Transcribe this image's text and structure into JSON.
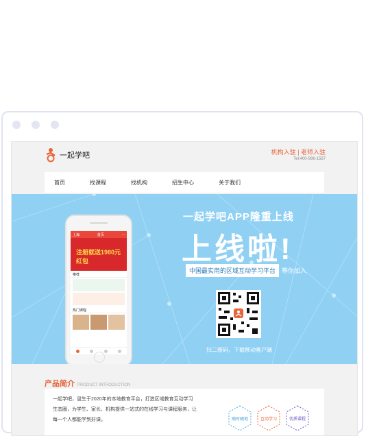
{
  "header": {
    "logo_text": "一起学吧",
    "links": "机构入驻 | 老师入驻",
    "phone": "Tel:400-996-1567"
  },
  "nav": {
    "items": [
      "首页",
      "找课程",
      "找机构",
      "招生中心",
      "关于我们"
    ]
  },
  "phone_screen": {
    "top_left": "上海",
    "top_center": "首页",
    "top_right": "...",
    "red_banner": "注册就送1980元红包",
    "row1": "推荐",
    "row2": "热门课程"
  },
  "banner": {
    "title": "一起学吧APP隆重上线",
    "big": "上线啦!",
    "sub_box": "中国最实用的区域互动学习平台",
    "sub_after": "等你加入",
    "qr_caption": "扫二维码，下载移动客户端",
    "colors": {
      "background": "#8fd0f3",
      "accent": "#e8643a"
    }
  },
  "intro": {
    "title": "产品简介",
    "title_en": "PRODUCT INTRODUCTION",
    "text": "一起学吧，诞生于2020年的本地教育平台，打造区域教育互动学习生态圈，为学生、家长、机构提供一站式的在线学习与课程服务，让每一个人都能学到好课。",
    "hex_labels": [
      "随时随地",
      "互动学习",
      "优质课程"
    ]
  }
}
